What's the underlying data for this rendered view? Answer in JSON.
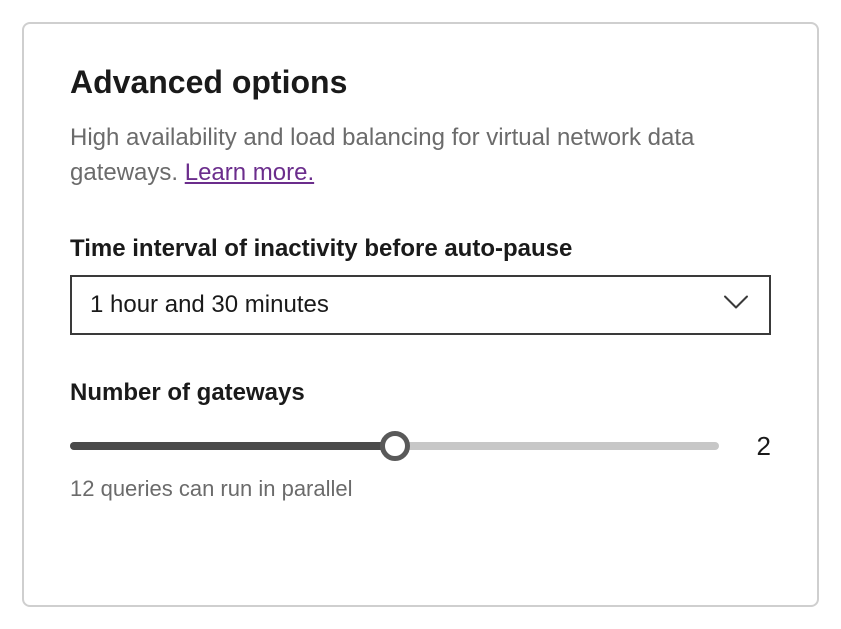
{
  "panel": {
    "title": "Advanced options",
    "description_prefix": "High availability and load balancing for virtual network data gateways. ",
    "learn_more": "Learn more."
  },
  "time_interval": {
    "label": "Time interval of inactivity before auto-pause",
    "selected": "1 hour and 30 minutes"
  },
  "gateways": {
    "label": "Number of gateways",
    "value": "2",
    "min": 1,
    "max": 3,
    "fill_percent": 50,
    "caption": "12 queries can run in parallel"
  }
}
